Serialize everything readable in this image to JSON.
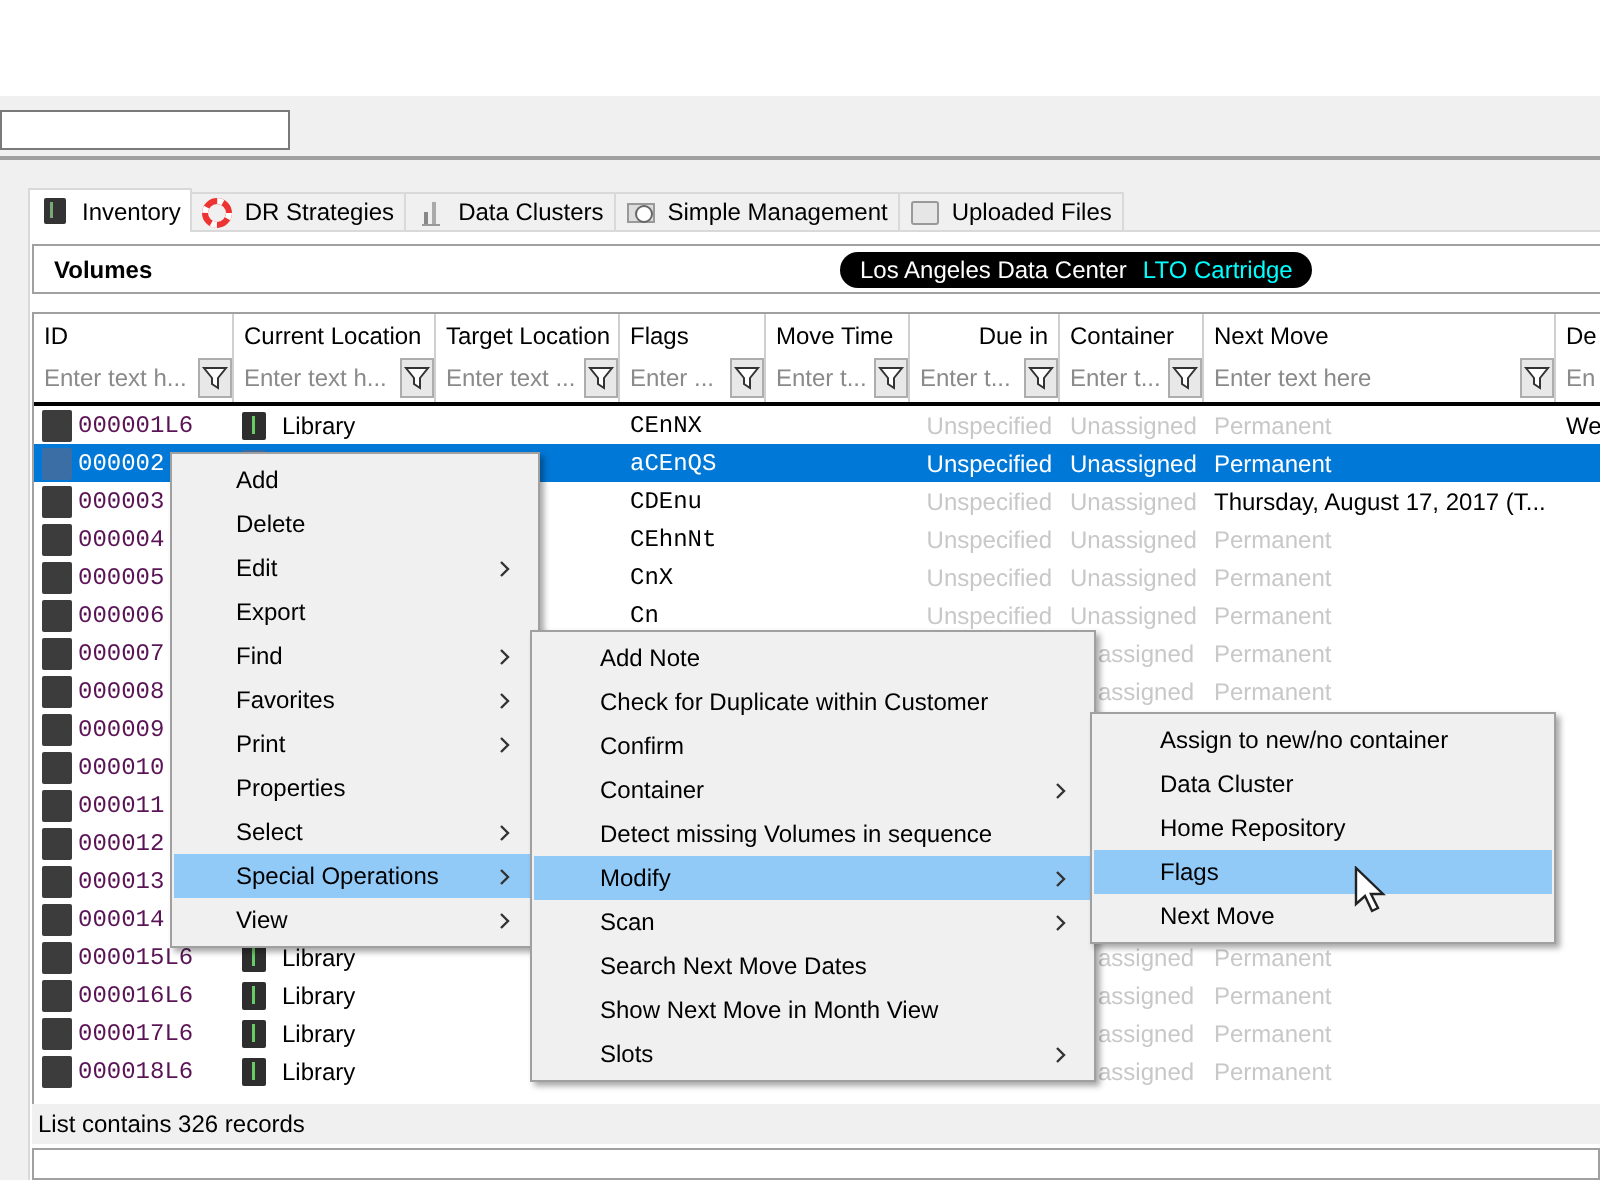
{
  "tabs": [
    {
      "label": "Inventory",
      "selected": true
    },
    {
      "label": "DR Strategies",
      "selected": false
    },
    {
      "label": "Data Clusters",
      "selected": false
    },
    {
      "label": "Simple Management",
      "selected": false
    },
    {
      "label": "Uploaded Files",
      "selected": false
    }
  ],
  "panel": {
    "title": "Volumes",
    "site": "Los Angeles Data Center",
    "media": "LTO Cartridge"
  },
  "table": {
    "columns": [
      {
        "label": "ID",
        "placeholder": "Enter text h..."
      },
      {
        "label": "Current Location",
        "placeholder": "Enter text h..."
      },
      {
        "label": "Target Location",
        "placeholder": "Enter text ..."
      },
      {
        "label": "Flags",
        "placeholder": "Enter ..."
      },
      {
        "label": "Move Time",
        "placeholder": "Enter t..."
      },
      {
        "label": "Due in",
        "placeholder": "Enter t..."
      },
      {
        "label": "Container",
        "placeholder": "Enter t..."
      },
      {
        "label": "Next Move",
        "placeholder": "Enter text here"
      },
      {
        "label": "De",
        "placeholder": "En"
      }
    ],
    "rows": [
      {
        "selected": false,
        "cells": [
          {
            "text": "000001L6",
            "icon": true
          },
          {
            "text": "Library",
            "icon": true
          },
          null,
          {
            "text": "CEnNX"
          },
          null,
          {
            "text": "Unspecified",
            "dim": true
          },
          {
            "text": "Unassigned",
            "dim": true
          },
          {
            "text": "Permanent",
            "dim": true
          },
          {
            "text": "We"
          }
        ]
      },
      {
        "selected": true,
        "cells": [
          {
            "text": "000002",
            "icon": true
          },
          {
            "icon": true
          },
          null,
          {
            "text": "aCEnQS"
          },
          null,
          {
            "text": "Unspecified"
          },
          {
            "text": "Unassigned"
          },
          {
            "text": "Permanent"
          },
          null
        ]
      },
      {
        "selected": false,
        "cells": [
          {
            "text": "000003",
            "icon": true
          },
          null,
          null,
          {
            "text": "CDEnu"
          },
          null,
          {
            "text": "Unspecified",
            "dim": true
          },
          {
            "text": "Unassigned",
            "dim": true
          },
          {
            "text": "Thursday, August 17, 2017 (T...",
            "dim": false
          },
          null
        ]
      },
      {
        "selected": false,
        "cells": [
          {
            "text": "000004",
            "icon": true
          },
          null,
          null,
          {
            "text": "CEhnNt"
          },
          null,
          {
            "text": "Unspecified",
            "dim": true
          },
          {
            "text": "Unassigned",
            "dim": true
          },
          {
            "text": "Permanent",
            "dim": true
          },
          null
        ]
      },
      {
        "selected": false,
        "cells": [
          {
            "text": "000005",
            "icon": true
          },
          null,
          null,
          {
            "text": "CnX"
          },
          null,
          {
            "text": "Unspecified",
            "dim": true
          },
          {
            "text": "Unassigned",
            "dim": true
          },
          {
            "text": "Permanent",
            "dim": true
          },
          null
        ]
      },
      {
        "selected": false,
        "cells": [
          {
            "text": "000006",
            "icon": true
          },
          null,
          null,
          {
            "text": "Cn"
          },
          null,
          {
            "text": "Unspecified",
            "dim": true
          },
          {
            "text": "Unassigned",
            "dim": true
          },
          {
            "text": "Permanent",
            "dim": true
          },
          null
        ]
      },
      {
        "selected": false,
        "cells": [
          {
            "text": "000007",
            "icon": true
          },
          null,
          null,
          null,
          null,
          null,
          {
            "text": "assigned",
            "dim": true,
            "cut": true
          },
          {
            "text": "Permanent",
            "dim": true
          },
          null
        ]
      },
      {
        "selected": false,
        "cells": [
          {
            "text": "000008",
            "icon": true
          },
          null,
          null,
          null,
          null,
          null,
          {
            "text": "assigned",
            "dim": true,
            "cut": true
          },
          {
            "text": "Permanent",
            "dim": true
          },
          null
        ]
      },
      {
        "selected": false,
        "cells": [
          {
            "text": "000009",
            "icon": true
          },
          null,
          null,
          null,
          null,
          null,
          null,
          null,
          null
        ]
      },
      {
        "selected": false,
        "cells": [
          {
            "text": "000010",
            "icon": true
          },
          null,
          null,
          null,
          null,
          null,
          null,
          null,
          null
        ]
      },
      {
        "selected": false,
        "cells": [
          {
            "text": "000011",
            "icon": true
          },
          null,
          null,
          null,
          null,
          null,
          null,
          null,
          null
        ]
      },
      {
        "selected": false,
        "cells": [
          {
            "text": "000012",
            "icon": true
          },
          null,
          null,
          null,
          null,
          null,
          null,
          null,
          null
        ]
      },
      {
        "selected": false,
        "cells": [
          {
            "text": "000013",
            "icon": true
          },
          null,
          null,
          null,
          null,
          null,
          null,
          null,
          null
        ]
      },
      {
        "selected": false,
        "cells": [
          {
            "text": "000014",
            "icon": true
          },
          null,
          null,
          null,
          null,
          null,
          null,
          null,
          null
        ]
      },
      {
        "selected": false,
        "cells": [
          {
            "text": "000015L6",
            "icon": true
          },
          {
            "text": "Library",
            "icon": true
          },
          null,
          null,
          null,
          null,
          {
            "text": "assigned",
            "dim": true,
            "cut": true
          },
          {
            "text": "Permanent",
            "dim": true
          },
          null
        ]
      },
      {
        "selected": false,
        "cells": [
          {
            "text": "000016L6",
            "icon": true
          },
          {
            "text": "Library",
            "icon": true
          },
          null,
          null,
          null,
          null,
          {
            "text": "assigned",
            "dim": true,
            "cut": true
          },
          {
            "text": "Permanent",
            "dim": true
          },
          null
        ]
      },
      {
        "selected": false,
        "cells": [
          {
            "text": "000017L6",
            "icon": true
          },
          {
            "text": "Library",
            "icon": true
          },
          null,
          null,
          null,
          null,
          {
            "text": "assigned",
            "dim": true,
            "cut": true
          },
          {
            "text": "Permanent",
            "dim": true
          },
          null
        ]
      },
      {
        "selected": false,
        "cells": [
          {
            "text": "000018L6",
            "icon": true
          },
          {
            "text": "Library",
            "icon": true
          },
          null,
          null,
          null,
          null,
          {
            "text": "assigned",
            "dim": true,
            "cut": true
          },
          {
            "text": "Permanent",
            "dim": true
          },
          null
        ]
      }
    ]
  },
  "status_bar": "List contains 326 records",
  "context_menu": {
    "items": [
      {
        "label": "Add",
        "submenu": false,
        "selected": false
      },
      {
        "label": "Delete",
        "submenu": false,
        "selected": false
      },
      {
        "label": "Edit",
        "submenu": true,
        "selected": false
      },
      {
        "label": "Export",
        "submenu": false,
        "selected": false
      },
      {
        "label": "Find",
        "submenu": true,
        "selected": false
      },
      {
        "label": "Favorites",
        "submenu": true,
        "selected": false
      },
      {
        "label": "Print",
        "submenu": true,
        "selected": false
      },
      {
        "label": "Properties",
        "submenu": false,
        "selected": false
      },
      {
        "label": "Select",
        "submenu": true,
        "selected": false
      },
      {
        "label": "Special Operations",
        "submenu": true,
        "selected": true
      },
      {
        "label": "View",
        "submenu": true,
        "selected": false
      }
    ]
  },
  "special_operations_menu": {
    "items": [
      {
        "label": "Add Note",
        "submenu": false,
        "selected": false
      },
      {
        "label": "Check for Duplicate within Customer",
        "submenu": false,
        "selected": false
      },
      {
        "label": "Confirm",
        "submenu": false,
        "selected": false
      },
      {
        "label": "Container",
        "submenu": true,
        "selected": false
      },
      {
        "label": "Detect missing Volumes in sequence",
        "submenu": false,
        "selected": false
      },
      {
        "label": "Modify",
        "submenu": true,
        "selected": true
      },
      {
        "label": "Scan",
        "submenu": true,
        "selected": false
      },
      {
        "label": "Search Next Move Dates",
        "submenu": false,
        "selected": false
      },
      {
        "label": "Show Next Move in Month View",
        "submenu": false,
        "selected": false
      },
      {
        "label": "Slots",
        "submenu": true,
        "selected": false
      }
    ]
  },
  "modify_menu": {
    "items": [
      {
        "label": "Assign to new/no container",
        "submenu": false,
        "selected": false
      },
      {
        "label": "Data Cluster",
        "submenu": false,
        "selected": false
      },
      {
        "label": "Home Repository",
        "submenu": false,
        "selected": false
      },
      {
        "label": "Flags",
        "submenu": false,
        "selected": true
      },
      {
        "label": "Next Move",
        "submenu": false,
        "selected": false
      }
    ]
  }
}
